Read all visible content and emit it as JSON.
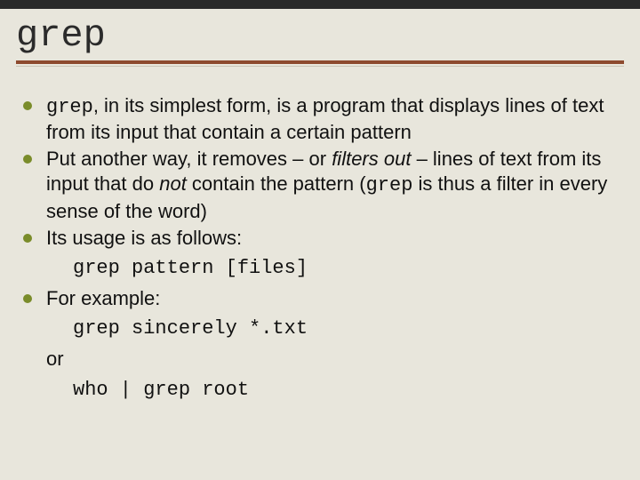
{
  "title": "grep",
  "bullets": {
    "b1": {
      "mono": "grep",
      "rest": ", in its simplest form, is a program that displays lines of text from its input that contain a certain pattern"
    },
    "b2": {
      "pre": "Put another way, it removes – or ",
      "it1": "filters out",
      "mid": " – lines of text from its input that do ",
      "it2": "not",
      "post1": " contain the pattern (",
      "mono": "grep",
      "post2": " is thus a filter in every sense of the word)"
    },
    "b3": "Its usage is as follows:",
    "code1": "grep pattern [files]",
    "b4": "For example:",
    "code2": "grep sincerely *.txt",
    "or": "or",
    "code3": "who | grep root"
  }
}
